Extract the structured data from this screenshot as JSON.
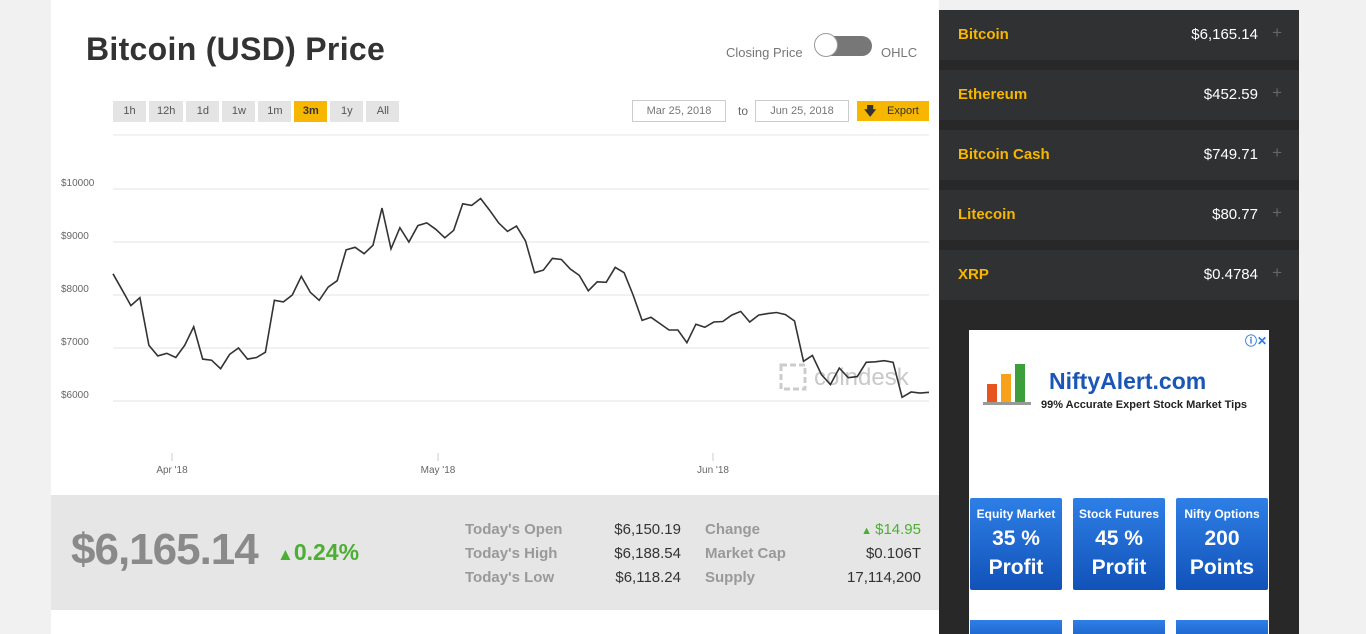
{
  "header": {
    "title": "Bitcoin (USD) Price",
    "toggle_left": "Closing Price",
    "toggle_right": "OHLC"
  },
  "range_buttons": [
    "1h",
    "12h",
    "1d",
    "1w",
    "1m",
    "3m",
    "1y",
    "All"
  ],
  "active_range": "3m",
  "dates": {
    "from": "Mar 25, 2018",
    "to_label": "to",
    "to": "Jun 25, 2018"
  },
  "export_label": "Export",
  "colors": {
    "accent": "#f7b600",
    "positive": "#4caf33",
    "sidebar_bg": "#282828"
  },
  "chart_data": {
    "type": "line",
    "watermark": "coindesk",
    "y_ticks": [
      "$10000",
      "$9000",
      "$8000",
      "$7000",
      "$6000"
    ],
    "x_ticks": [
      "Apr '18",
      "May '18",
      "Jun '18"
    ],
    "ylim": [
      6000,
      10000
    ],
    "x_range": [
      "2018-03-25",
      "2018-06-25"
    ],
    "series": [
      {
        "values": [
          8400,
          8100,
          7800,
          7950,
          7050,
          6850,
          6900,
          6820,
          7050,
          7400,
          6790,
          6770,
          6610,
          6880,
          7000,
          6790,
          6820,
          6920,
          7900,
          7870,
          8000,
          8350,
          8050,
          7900,
          8150,
          8270,
          8850,
          8900,
          8780,
          8940,
          9640,
          8870,
          9270,
          9000,
          9310,
          9360,
          9240,
          9080,
          9220,
          9720,
          9690,
          9820,
          9600,
          9360,
          9200,
          9300,
          9020,
          8420,
          8470,
          8690,
          8670,
          8490,
          8370,
          8080,
          8250,
          8240,
          8520,
          8420,
          8000,
          7520,
          7580,
          7460,
          7340,
          7340,
          7100,
          7450,
          7390,
          7490,
          7500,
          7620,
          7690,
          7490,
          7620,
          7650,
          7670,
          7630,
          7510,
          6750,
          6860,
          6500,
          6310,
          6620,
          6440,
          6460,
          6730,
          6740,
          6760,
          6730,
          6070,
          6170,
          6150,
          6165
        ]
      }
    ]
  },
  "stats": {
    "price": "$6,165.14",
    "change_pct": "0.24%",
    "rows": [
      {
        "label": "Today's Open",
        "value": "$6,150.19"
      },
      {
        "label": "Today's High",
        "value": "$6,188.54"
      },
      {
        "label": "Today's Low",
        "value": "$6,118.24"
      }
    ],
    "rows2": [
      {
        "label": "Change",
        "value": "$14.95"
      },
      {
        "label": "Market Cap",
        "value": "$0.106T"
      },
      {
        "label": "Supply",
        "value": "17,114,200"
      }
    ]
  },
  "sidebar": {
    "coins": [
      {
        "name": "Bitcoin",
        "price": "$6,165.14"
      },
      {
        "name": "Ethereum",
        "price": "$452.59"
      },
      {
        "name": "Bitcoin Cash",
        "price": "$749.71"
      },
      {
        "name": "Litecoin",
        "price": "$80.77"
      },
      {
        "name": "XRP",
        "price": "$0.4784"
      }
    ],
    "plus": "+"
  },
  "ad": {
    "brand": "NiftyAlert",
    "brand_suffix": ".com",
    "tagline": "99% Accurate Expert Stock Market Tips",
    "close": "ⓘ✕",
    "boxes": [
      {
        "heading": "Equity Market",
        "line1": "35 %",
        "line2": "Profit"
      },
      {
        "heading": "Stock Futures",
        "line1": "45 %",
        "line2": "Profit"
      },
      {
        "heading": "Nifty Options",
        "line1": "200",
        "line2": "Points"
      }
    ]
  }
}
